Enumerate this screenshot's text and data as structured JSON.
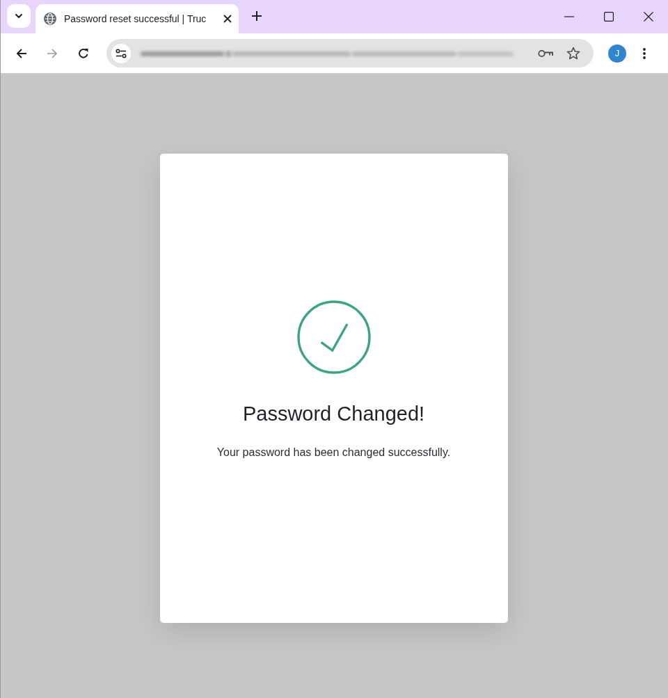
{
  "browser": {
    "tabs": [
      {
        "title": "Password reset successful | Truc",
        "selected": true
      }
    ],
    "profile_initial": "J"
  },
  "dialog": {
    "title": "Password Changed!",
    "message": "Your password has been changed successfully."
  }
}
